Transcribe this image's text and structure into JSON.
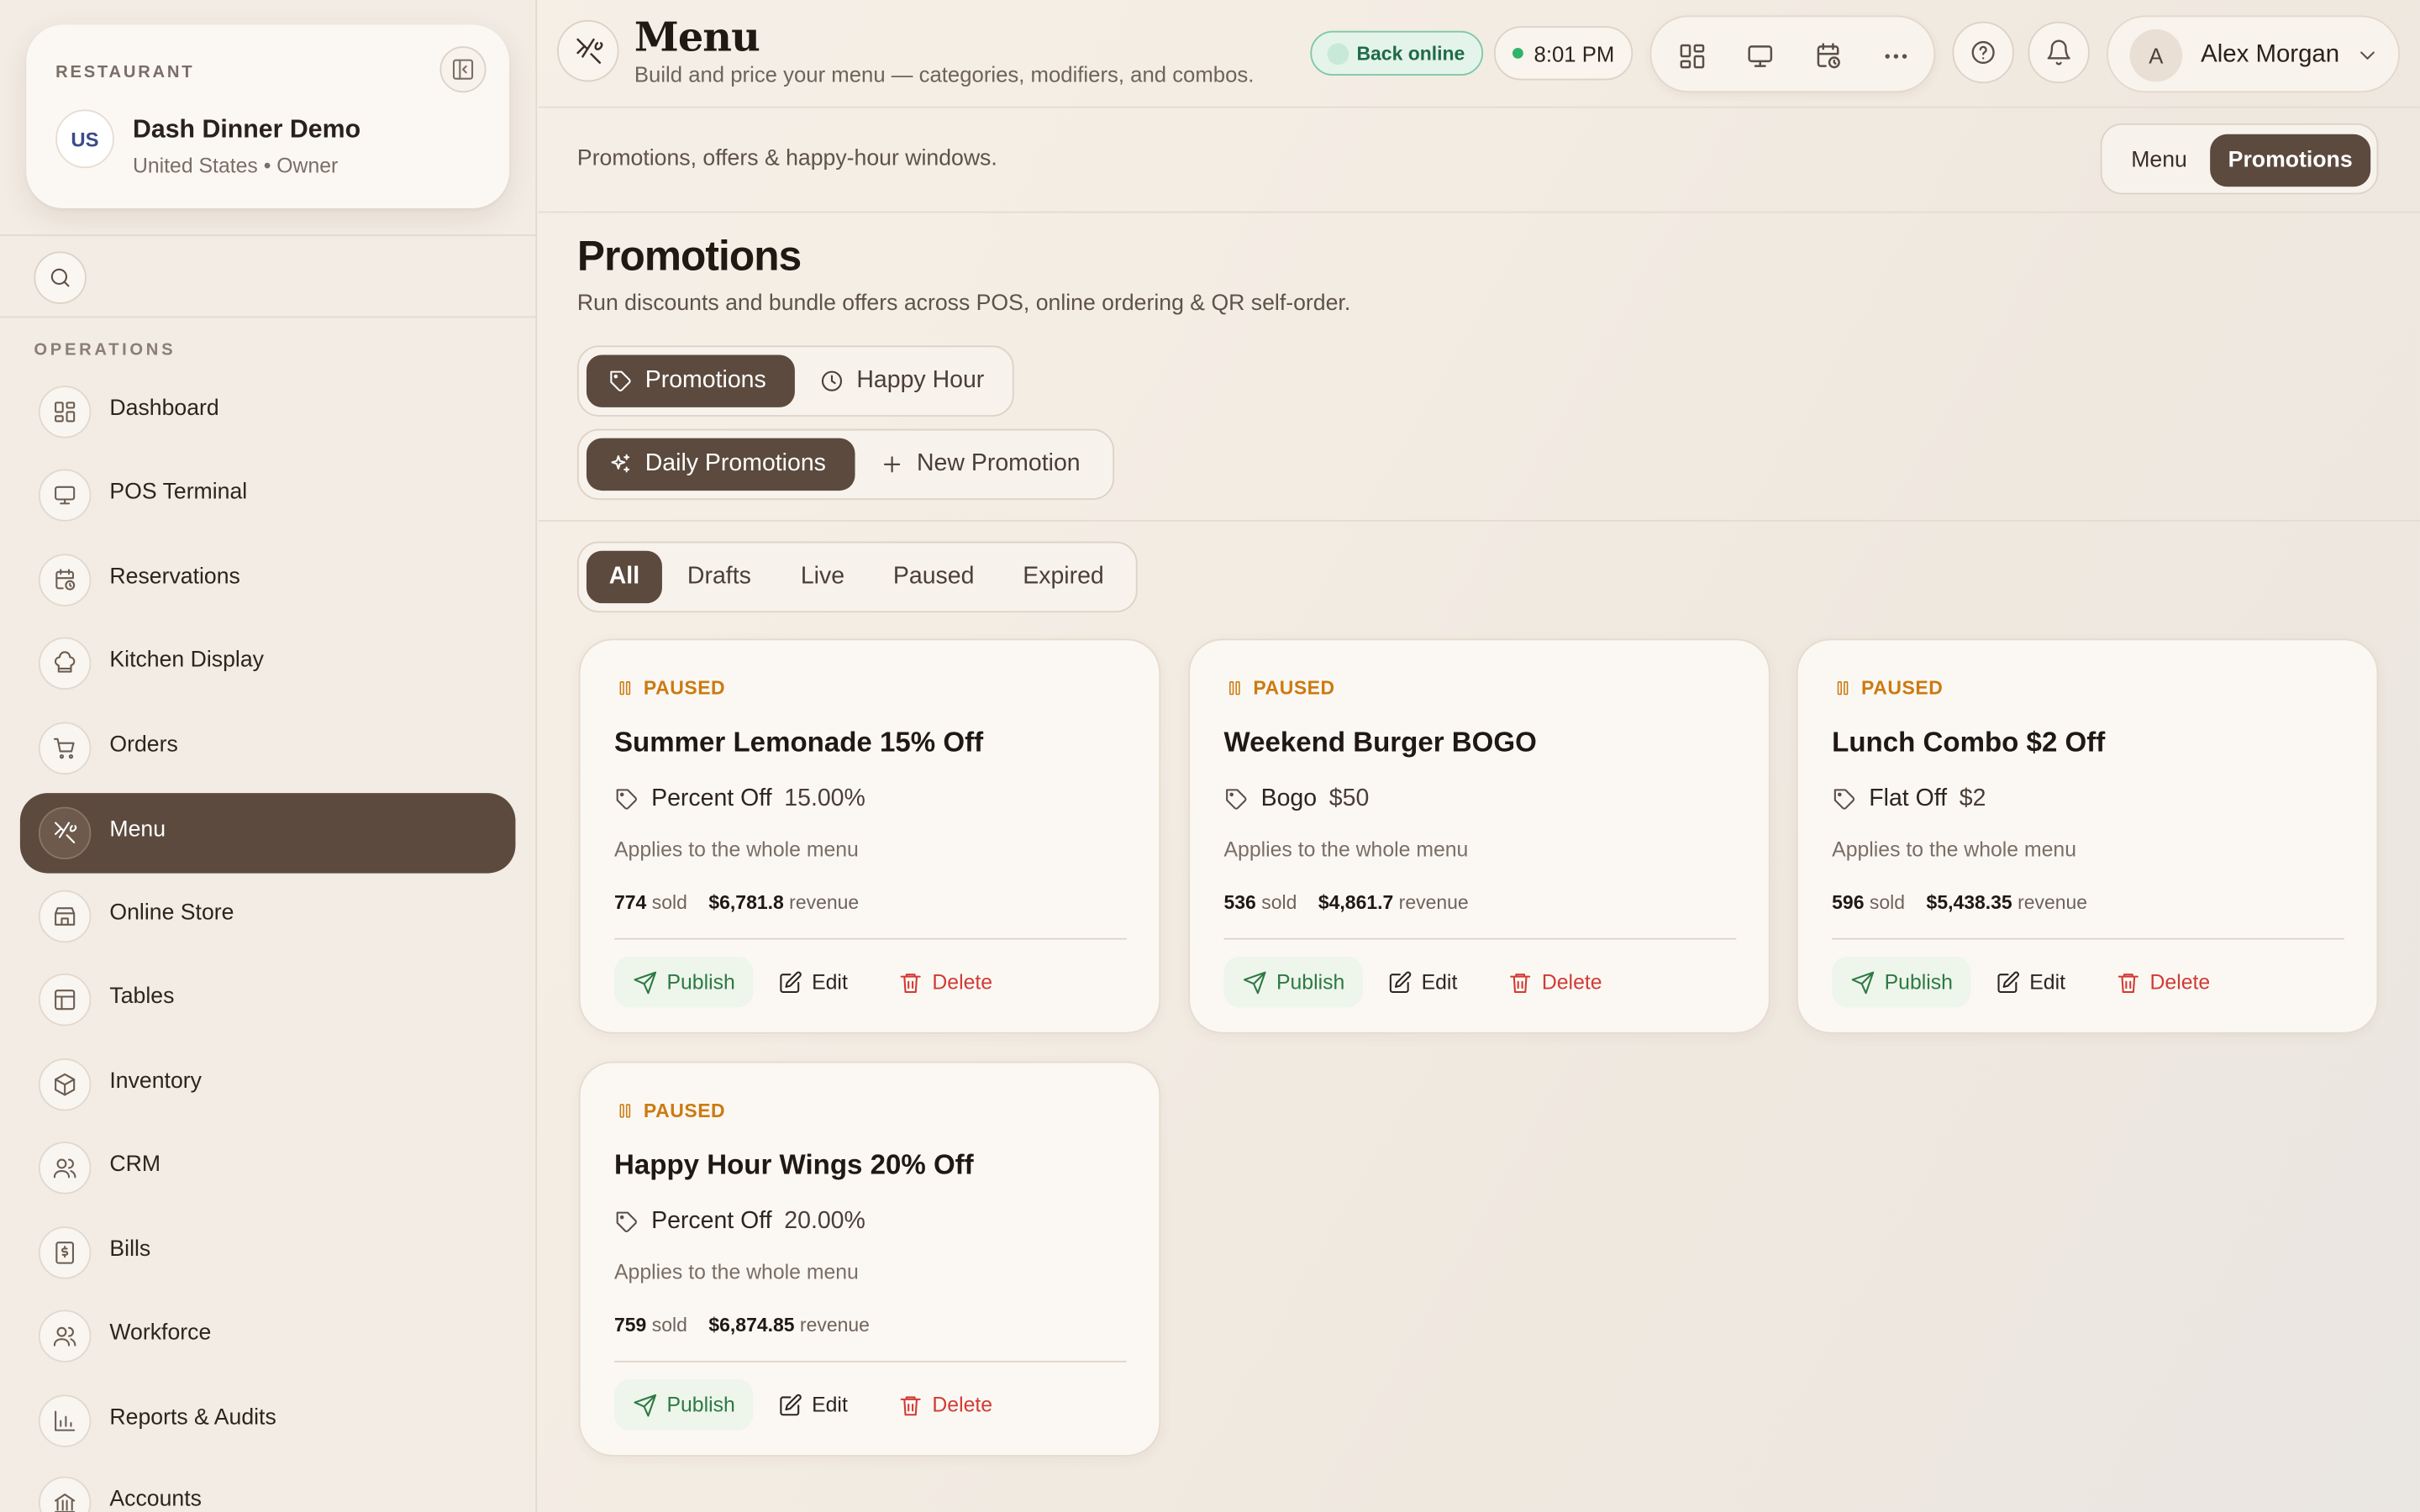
{
  "restaurant": {
    "label": "RESTAURANT",
    "flag": "US",
    "name": "Dash Dinner Demo",
    "sub": "United States • Owner"
  },
  "sidebar": {
    "section": "OPERATIONS",
    "items": [
      {
        "label": "Dashboard",
        "icon": "dashboard-icon"
      },
      {
        "label": "POS Terminal",
        "icon": "monitor-icon"
      },
      {
        "label": "Reservations",
        "icon": "calendar-clock-icon"
      },
      {
        "label": "Kitchen Display",
        "icon": "chef-hat-icon"
      },
      {
        "label": "Orders",
        "icon": "cart-icon"
      },
      {
        "label": "Menu",
        "icon": "utensils-icon",
        "active": true
      },
      {
        "label": "Online Store",
        "icon": "store-icon"
      },
      {
        "label": "Tables",
        "icon": "table-icon"
      },
      {
        "label": "Inventory",
        "icon": "box-icon"
      },
      {
        "label": "CRM",
        "icon": "users-icon"
      },
      {
        "label": "Bills",
        "icon": "bill-icon"
      },
      {
        "label": "Workforce",
        "icon": "users-icon"
      },
      {
        "label": "Reports & Audits",
        "icon": "chart-icon"
      },
      {
        "label": "Accounts",
        "icon": "bank-icon"
      }
    ]
  },
  "header": {
    "title": "Menu",
    "subtitle": "Build and price your menu — categories, modifiers, and combos.",
    "status": "Back online",
    "time": "8:01 PM",
    "user": {
      "initial": "A",
      "name": "Alex Morgan"
    }
  },
  "subbar": {
    "text": "Promotions, offers & happy-hour windows.",
    "seg": [
      "Menu",
      "Promotions"
    ],
    "active_seg": "Promotions"
  },
  "promotions": {
    "title": "Promotions",
    "subtitle": "Run discounts and bundle offers across POS, online ordering & QR self-order.",
    "tabs": [
      "Promotions",
      "Happy Hour"
    ],
    "subtabs": [
      "Daily Promotions",
      "New Promotion"
    ],
    "filters": [
      "All",
      "Drafts",
      "Live",
      "Paused",
      "Expired"
    ],
    "active_filter": "All"
  },
  "cards": [
    {
      "status": "PAUSED",
      "title": "Summer Lemonade 15% Off",
      "type": "Percent Off",
      "value": "15.00%",
      "applies": "Applies to the whole menu",
      "sold": "774",
      "sold_label": "sold",
      "revenue": "$6,781.8",
      "revenue_label": "revenue"
    },
    {
      "status": "PAUSED",
      "title": "Weekend Burger BOGO",
      "type": "Bogo",
      "value": "$50",
      "applies": "Applies to the whole menu",
      "sold": "536",
      "sold_label": "sold",
      "revenue": "$4,861.7",
      "revenue_label": "revenue"
    },
    {
      "status": "PAUSED",
      "title": "Lunch Combo $2 Off",
      "type": "Flat Off",
      "value": "$2",
      "applies": "Applies to the whole menu",
      "sold": "596",
      "sold_label": "sold",
      "revenue": "$5,438.35",
      "revenue_label": "revenue"
    },
    {
      "status": "PAUSED",
      "title": "Happy Hour Wings 20% Off",
      "type": "Percent Off",
      "value": "20.00%",
      "applies": "Applies to the whole menu",
      "sold": "759",
      "sold_label": "sold",
      "revenue": "$6,874.85",
      "revenue_label": "revenue"
    }
  ],
  "actions": {
    "publish": "Publish",
    "edit": "Edit",
    "delete": "Delete"
  },
  "colors": {
    "accent": "#5c4a3e",
    "paused": "#cc7a10",
    "publish": "#2c7a45",
    "delete": "#d23a34",
    "online": "#2fb36b"
  }
}
